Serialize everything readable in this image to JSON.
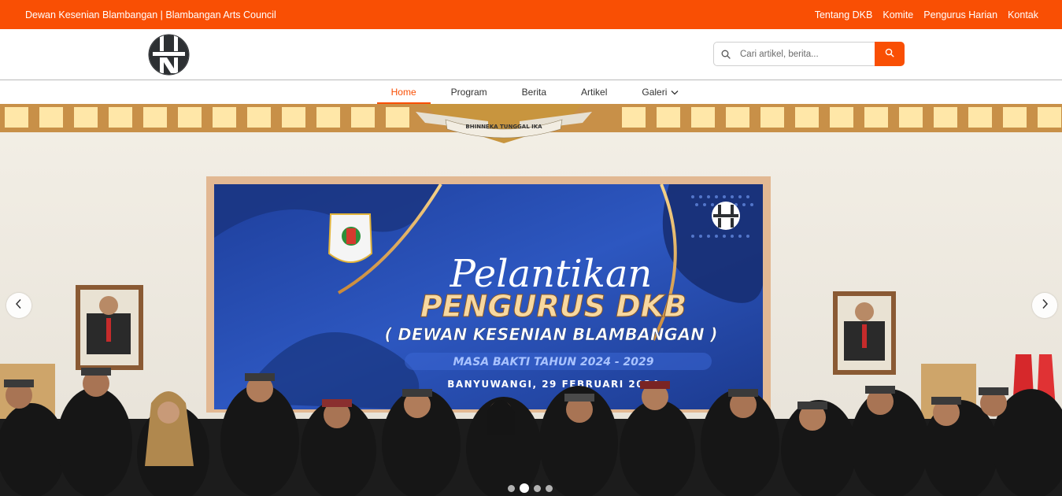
{
  "topbar": {
    "site_name": "Dewan Kesenian Blambangan | Blambangan Arts Council",
    "links": [
      "Tentang DKB",
      "Komite",
      "Pengurus Harian",
      "Kontak"
    ]
  },
  "search": {
    "placeholder": "Cari artikel, berita...",
    "value": ""
  },
  "nav": {
    "items": [
      "Home",
      "Program",
      "Berita",
      "Artikel",
      "Galeri"
    ],
    "active": "Home"
  },
  "hero": {
    "banner": {
      "script_line": "Pelantikan",
      "title_line": "PENGURUS DKB",
      "subtitle_line": "( DEWAN KESENIAN BLAMBANGAN )",
      "period_line": "MASA BAKTI TAHUN 2024 - 2029",
      "location_line": "BANYUWANGI, 29 FEBRUARI 2024"
    },
    "emblem_ribbon": "BHINNEKA TUNGGAL IKA",
    "slide_count": 4,
    "active_slide": 2
  },
  "colors": {
    "brand_orange": "#f94f04",
    "banner_blue": "#2a49a8",
    "banner_gold": "#e8b25a"
  },
  "icons": {
    "search": "search-icon",
    "prev": "chevron-left-icon",
    "next": "chevron-right-icon",
    "dropdown": "chevron-down-icon"
  }
}
